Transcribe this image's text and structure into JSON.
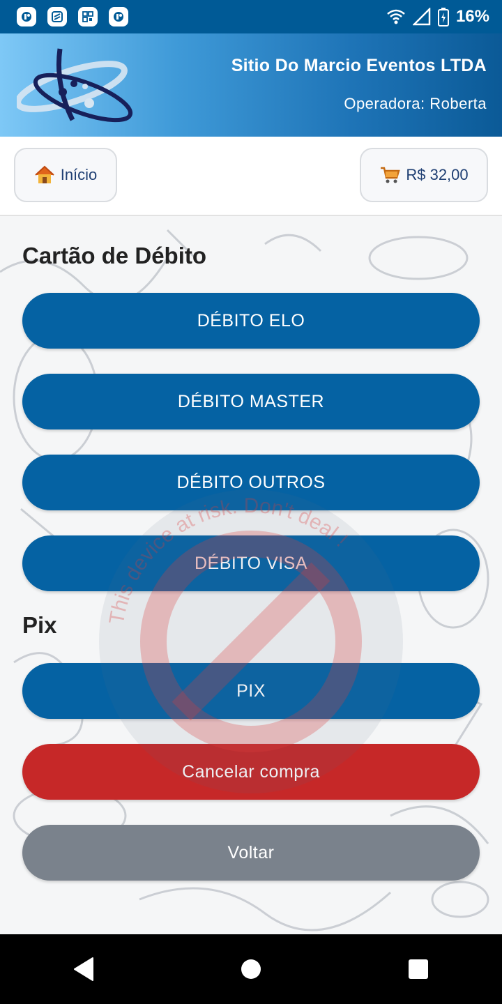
{
  "status_bar": {
    "battery": "16%",
    "icons": [
      "app-icon",
      "app-icon",
      "app-icon",
      "app-icon",
      "wifi-icon",
      "signal-icon",
      "battery-charging-icon"
    ]
  },
  "header": {
    "company": "Sitio Do Marcio Eventos LTDA",
    "operator": "Operadora: Roberta"
  },
  "toolbar": {
    "home_label": "Início",
    "cart_total": "R$ 32,00"
  },
  "sections": {
    "debit_title": "Cartão de Débito",
    "pix_title": "Pix"
  },
  "buttons": {
    "debit_elo": "DÉBITO ELO",
    "debit_master": "DÉBITO MASTER",
    "debit_outros": "DÉBITO OUTROS",
    "debit_visa": "DÉBITO VISA",
    "pix": "PIX",
    "cancel": "Cancelar compra",
    "back": "Voltar"
  },
  "watermark": {
    "text": "This device at risk. Don't deal !"
  },
  "colors": {
    "primary": "#0562a3",
    "danger": "#c62828",
    "secondary": "#7a828c",
    "status_bar": "#005a96"
  }
}
